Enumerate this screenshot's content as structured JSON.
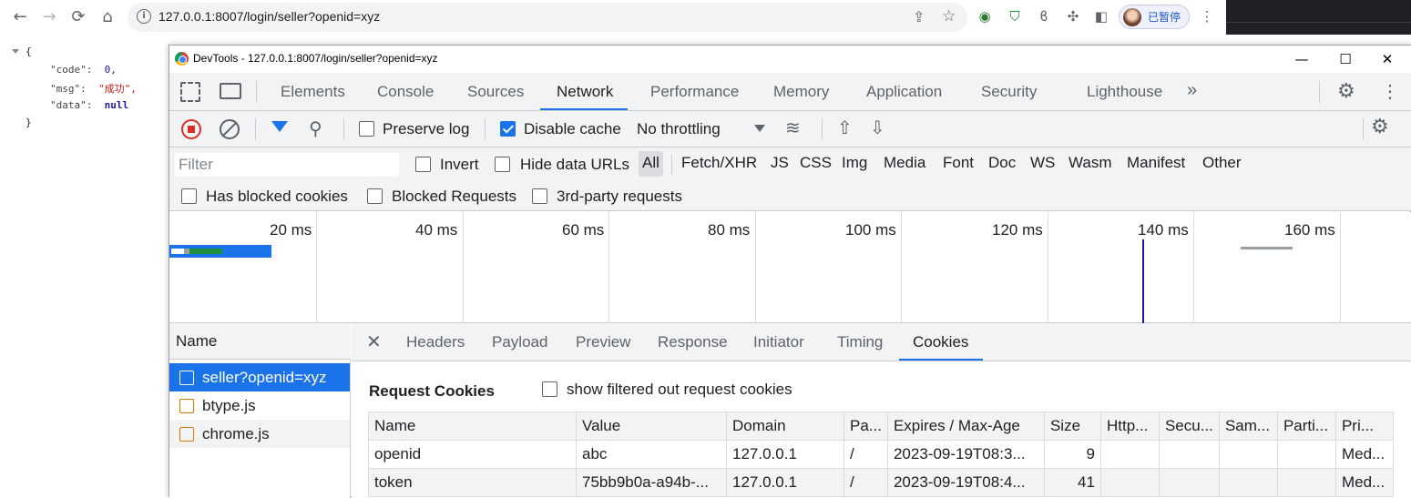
{
  "browser": {
    "url": "127.0.0.1:8007/login/seller?openid=xyz",
    "profile_label": "已暂停"
  },
  "json_view": {
    "open_brace": "{",
    "close_brace": "}",
    "lines": [
      {
        "key": "\"code\":",
        "value": "0,"
      },
      {
        "key": "\"msg\":",
        "value": "\"成功\","
      },
      {
        "key": "\"data\":",
        "value": "null"
      }
    ]
  },
  "devtools": {
    "title": "DevTools - 127.0.0.1:8007/login/seller?openid=xyz",
    "tabs": [
      "Elements",
      "Console",
      "Sources",
      "Network",
      "Performance",
      "Memory",
      "Application",
      "Security",
      "Lighthouse"
    ],
    "active_tab": "Network",
    "toolbar": {
      "preserve_log": "Preserve log",
      "disable_cache": "Disable cache",
      "throttling": "No throttling"
    },
    "filter": {
      "placeholder": "Filter",
      "invert": "Invert",
      "hide_data_urls": "Hide data URLs",
      "types": [
        "All",
        "Fetch/XHR",
        "JS",
        "CSS",
        "Img",
        "Media",
        "Font",
        "Doc",
        "WS",
        "Wasm",
        "Manifest",
        "Other"
      ],
      "selected_type": "All",
      "has_blocked_cookies": "Has blocked cookies",
      "blocked_requests": "Blocked Requests",
      "third_party": "3rd-party requests"
    },
    "overview": {
      "ticks": [
        "20 ms",
        "40 ms",
        "60 ms",
        "80 ms",
        "100 ms",
        "120 ms",
        "140 ms",
        "160 ms"
      ]
    },
    "requests": {
      "header": "Name",
      "items": [
        {
          "name": "seller?openid=xyz",
          "type": "doc"
        },
        {
          "name": "btype.js",
          "type": "script"
        },
        {
          "name": "chrome.js",
          "type": "script"
        }
      ]
    },
    "detail": {
      "tabs": [
        "Headers",
        "Payload",
        "Preview",
        "Response",
        "Initiator",
        "Timing",
        "Cookies"
      ],
      "active_tab": "Cookies",
      "section_title": "Request Cookies",
      "show_filtered": "show filtered out request cookies",
      "columns": [
        "Name",
        "Value",
        "Domain",
        "Pa...",
        "Expires / Max-Age",
        "Size",
        "Http...",
        "Secu...",
        "Sam...",
        "Parti...",
        "Pri..."
      ],
      "rows": [
        [
          "openid",
          "abc",
          "127.0.0.1",
          "/",
          "2023-09-19T08:3...",
          "9",
          "",
          "",
          "",
          "",
          "Med..."
        ],
        [
          "token",
          "75bb9b0a-a94b-...",
          "127.0.0.1",
          "/",
          "2023-09-19T08:4...",
          "41",
          "",
          "",
          "",
          "",
          "Med..."
        ]
      ]
    }
  }
}
